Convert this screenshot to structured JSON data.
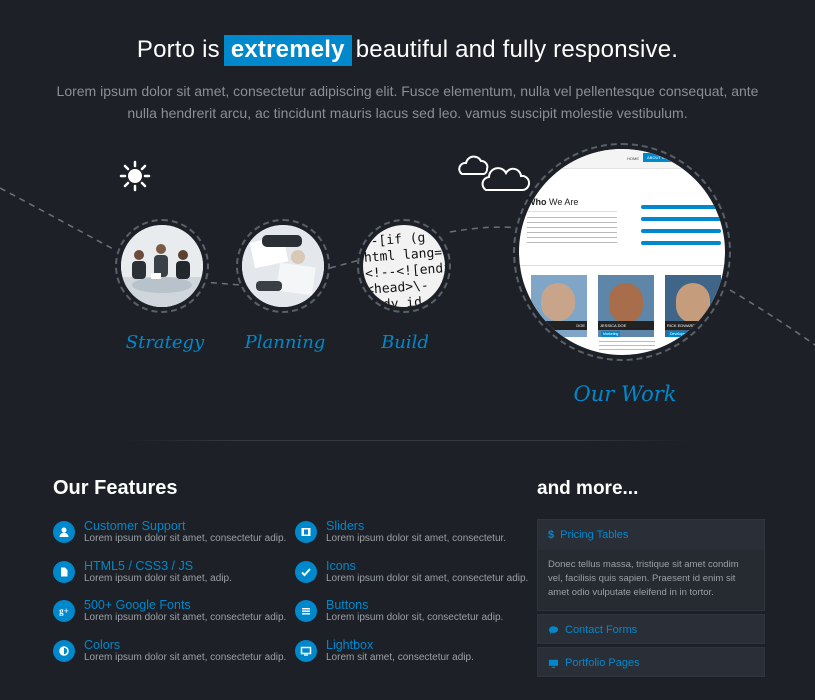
{
  "hero": {
    "title_before": "Porto is",
    "title_highlight": "extremely",
    "title_after": "beautiful and fully responsive.",
    "subtitle": "Lorem ipsum dolor sit amet, consectetur adipiscing elit. Fusce elementum, nulla vel pellentesque consequat, ante nulla hendrerit arcu, ac tincidunt mauris lacus sed leo. vamus suscipit molestie vestibulum."
  },
  "process": {
    "steps": [
      {
        "label": "Strategy"
      },
      {
        "label": "Planning"
      },
      {
        "label": "Build"
      }
    ],
    "our_work": {
      "label": "Our Work",
      "preview": {
        "nav_home": "HOME",
        "nav_about": "ABOUT US",
        "heading_bold": "Who",
        "heading_rest": "We Are",
        "team": [
          {
            "name": "DOE",
            "role": ""
          },
          {
            "name": "JESSICA DOE",
            "role": "Marketing"
          },
          {
            "name": "RICK EDWARD DOE",
            "role": "Developer"
          }
        ]
      }
    },
    "code_lines": [
      "--[if (g",
      "html lang=",
      "<!--<![endi",
      "<head>\\-",
      "body id"
    ]
  },
  "features": {
    "title_light": "Our",
    "title_bold": "Features",
    "items": [
      {
        "icon": "user-group-icon",
        "title": "Customer Support",
        "desc": "Lorem ipsum dolor sit amet, consectetur adip."
      },
      {
        "icon": "film-icon",
        "title": "Sliders",
        "desc": "Lorem ipsum dolor sit amet, consectetur."
      },
      {
        "icon": "file-icon",
        "title": "HTML5 / CSS3 / JS",
        "desc": "Lorem ipsum dolor sit amet, adip."
      },
      {
        "icon": "check-icon",
        "title": "Icons",
        "desc": "Lorem ipsum dolor sit amet, consectetur adip."
      },
      {
        "icon": "google-plus-icon",
        "title": "500+ Google Fonts",
        "desc": "Lorem ipsum dolor sit amet, consectetur adip."
      },
      {
        "icon": "list-icon",
        "title": "Buttons",
        "desc": "Lorem ipsum dolor sit, consectetur adip."
      },
      {
        "icon": "contrast-icon",
        "title": "Colors",
        "desc": "Lorem ipsum dolor sit amet, consectetur adip."
      },
      {
        "icon": "monitor-icon",
        "title": "Lightbox",
        "desc": "Lorem sit amet, consectetur adip."
      }
    ]
  },
  "more": {
    "title": "and more...",
    "panels": [
      {
        "icon": "dollar-icon",
        "title": "Pricing Tables",
        "body": "Donec tellus massa, tristique sit amet condim vel, facilisis quis sapien. Praesent id enim sit amet odio vulputate eleifend in in tortor."
      },
      {
        "icon": "chat-icon",
        "title": "Contact Forms"
      },
      {
        "icon": "monitor-icon",
        "title": "Portfolio Pages"
      }
    ]
  },
  "colors": {
    "background": "#1d2127",
    "accent": "#0088cc",
    "panel": "#2a2f37"
  }
}
